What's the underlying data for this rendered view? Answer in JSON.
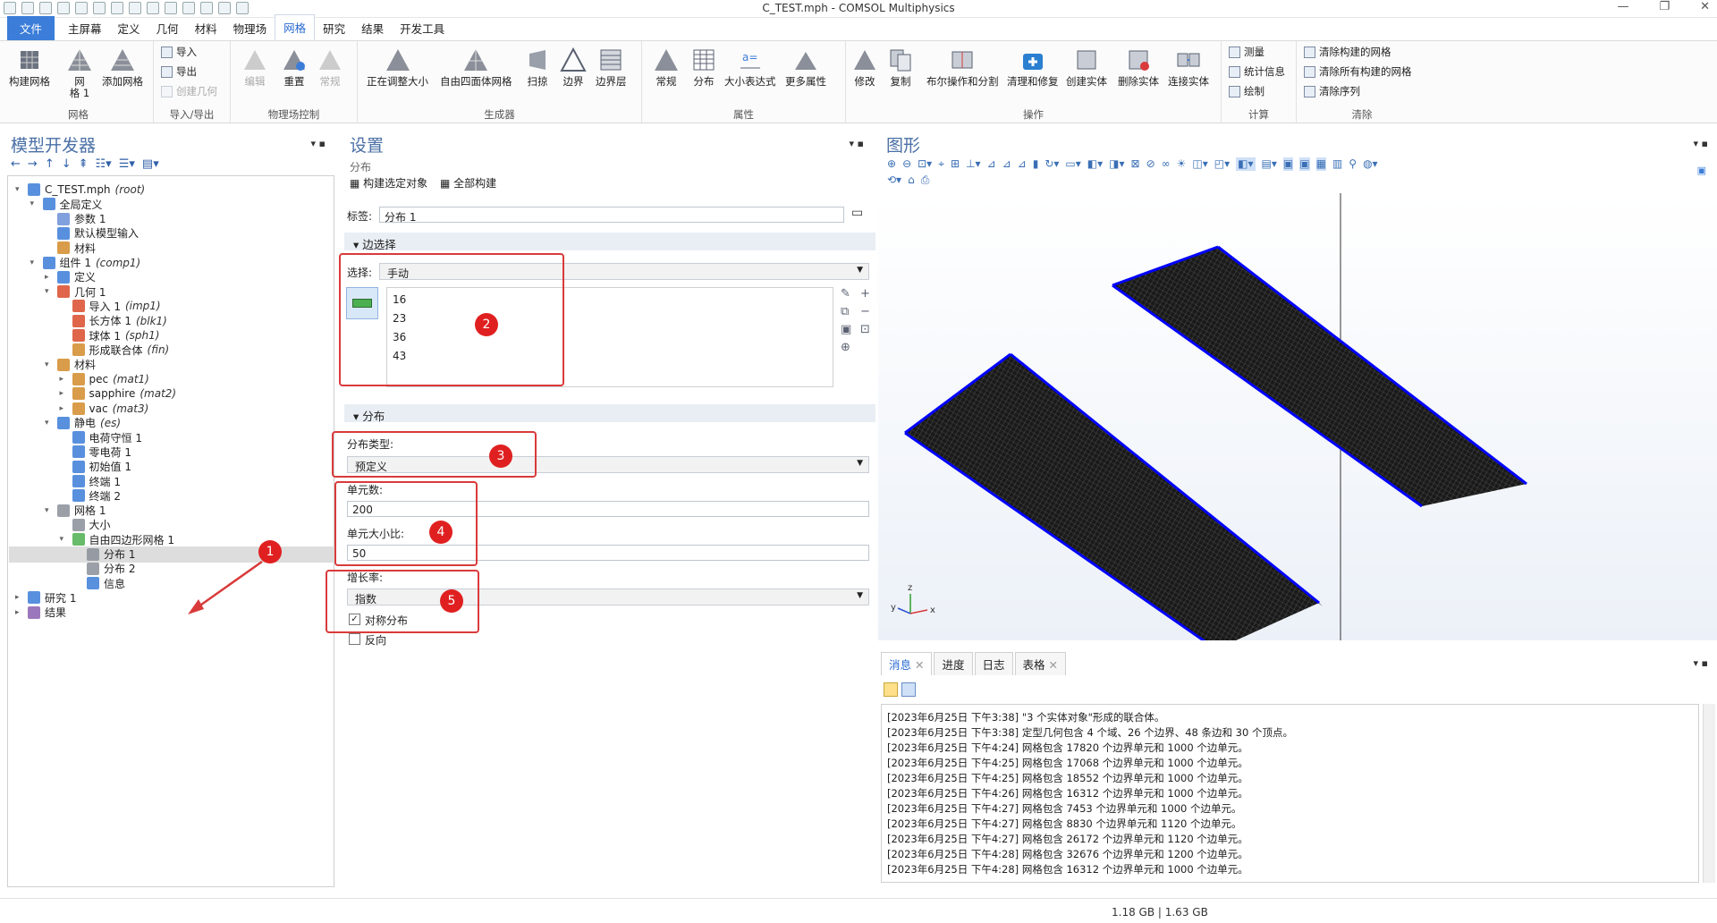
{
  "window": {
    "title": "C_TEST.mph - COMSOL Multiphysics"
  },
  "menu": [
    "文件",
    "主屏幕",
    "定义",
    "几何",
    "材料",
    "物理场",
    "网格",
    "研究",
    "结果",
    "开发工具"
  ],
  "ribbon": {
    "mesh_group": {
      "build_mesh": "构建网格",
      "mesh1": "网\n格 1",
      "add_mesh": "添加网格",
      "label": "网格"
    },
    "import_group": {
      "import": "导入",
      "export": "导出",
      "create_geom": "创建几何",
      "label": "导入/导出"
    },
    "physics_group": {
      "edit": "编辑",
      "reset": "重置",
      "normal": "常规",
      "label": "物理场控制"
    },
    "generator_group": {
      "adjust": "正在调整大小",
      "free_tet": "自由四面体网格",
      "sweep": "扫掠",
      "boundary": "边界",
      "boundary_layer": "边界层",
      "label": "生成器"
    },
    "attributes_group": {
      "normal": "常规",
      "distribution": "分布",
      "size_expr": "大小表达式",
      "more": "更多属性",
      "label": "属性"
    },
    "operations_group": {
      "modify": "修改",
      "copy": "复制",
      "boolean": "布尔操作和分割",
      "cleanup": "清理和修复",
      "create_entity": "创建实体",
      "delete_entity": "删除实体",
      "connect_entity": "连接实体",
      "label": "操作"
    },
    "compute_group": {
      "measure": "测量",
      "stats": "统计信息",
      "plot": "绘制",
      "label": "计算"
    },
    "clear_group": {
      "clear_built": "清除构建的网格",
      "clear_all": "清除所有构建的网格",
      "clear_seq": "清除序列",
      "label": "清除"
    }
  },
  "model_builder": {
    "title": "模型开发器",
    "tree": [
      {
        "label": "C_TEST.mph",
        "tag": "(root)"
      },
      {
        "label": "全局定义",
        "tag": ""
      },
      {
        "label": "参数 1",
        "tag": ""
      },
      {
        "label": "默认模型输入",
        "tag": ""
      },
      {
        "label": "材料",
        "tag": ""
      },
      {
        "label": "组件 1",
        "tag": "(comp1)"
      },
      {
        "label": "定义",
        "tag": ""
      },
      {
        "label": "几何 1",
        "tag": ""
      },
      {
        "label": "导入 1",
        "tag": "(imp1)"
      },
      {
        "label": "长方体 1",
        "tag": "(blk1)"
      },
      {
        "label": "球体 1",
        "tag": "(sph1)"
      },
      {
        "label": "形成联合体",
        "tag": "(fin)"
      },
      {
        "label": "材料",
        "tag": ""
      },
      {
        "label": "pec",
        "tag": "(mat1)"
      },
      {
        "label": "sapphire",
        "tag": "(mat2)"
      },
      {
        "label": "vac",
        "tag": "(mat3)"
      },
      {
        "label": "静电",
        "tag": "(es)"
      },
      {
        "label": "电荷守恒 1",
        "tag": ""
      },
      {
        "label": "零电荷 1",
        "tag": ""
      },
      {
        "label": "初始值 1",
        "tag": ""
      },
      {
        "label": "终端 1",
        "tag": ""
      },
      {
        "label": "终端 2",
        "tag": ""
      },
      {
        "label": "网格 1",
        "tag": ""
      },
      {
        "label": "大小",
        "tag": ""
      },
      {
        "label": "自由四边形网格 1",
        "tag": ""
      },
      {
        "label": "分布 1",
        "tag": ""
      },
      {
        "label": "分布 2",
        "tag": ""
      },
      {
        "label": "信息",
        "tag": ""
      },
      {
        "label": "研究 1",
        "tag": ""
      },
      {
        "label": "结果",
        "tag": ""
      }
    ]
  },
  "settings": {
    "title": "设置",
    "subtitle": "分布",
    "build_selected": "构建选定对象",
    "build_all": "全部构建",
    "label_caption": "标签:",
    "label_value": "分布 1",
    "edge_section": "边选择",
    "selection_caption": "选择:",
    "selection_value": "手动",
    "edges": [
      "16",
      "23",
      "36",
      "43"
    ],
    "dist_section": "分布",
    "dist_type_caption": "分布类型:",
    "dist_type_value": "预定义",
    "elements_caption": "单元数:",
    "elements_value": "200",
    "ratio_caption": "单元大小比:",
    "ratio_value": "50",
    "growth_caption": "增长率:",
    "growth_value": "指数",
    "symmetric": "对称分布",
    "reverse": "反向",
    "symmetric_checked": true,
    "reverse_checked": false
  },
  "badges": [
    "1",
    "2",
    "3",
    "4",
    "5"
  ],
  "graphics": {
    "title": "图形",
    "axis_x": "x",
    "axis_y": "y",
    "axis_z": "z"
  },
  "messages": {
    "tabs": [
      "消息",
      "进度",
      "日志",
      "表格"
    ],
    "lines": [
      "[2023年6月25日 下午3:38] \"3 个实体对象\"形成的联合体。",
      "[2023年6月25日 下午3:38] 定型几何包含 4 个域、26 个边界、48 条边和 30 个顶点。",
      "[2023年6月25日 下午4:24] 网格包含 17820 个边界单元和 1000 个边单元。",
      "[2023年6月25日 下午4:25] 网格包含 17068 个边界单元和 1000 个边单元。",
      "[2023年6月25日 下午4:25] 网格包含 18552 个边界单元和 1000 个边单元。",
      "[2023年6月25日 下午4:26] 网格包含 16312 个边界单元和 1000 个边单元。",
      "[2023年6月25日 下午4:27] 网格包含 7453 个边界单元和 1000 个边单元。",
      "[2023年6月25日 下午4:27] 网格包含 8830 个边界单元和 1120 个边单元。",
      "[2023年6月25日 下午4:27] 网格包含 26172 个边界单元和 1120 个边单元。",
      "[2023年6月25日 下午4:28] 网格包含 32676 个边界单元和 1200 个边单元。",
      "[2023年6月25日 下午4:28] 网格包含 16312 个边界单元和 1000 个边单元。"
    ]
  },
  "status": {
    "memory": "1.18 GB | 1.63 GB"
  },
  "colors": {
    "accent": "#3b7dd8",
    "annotation": "#d93a3a",
    "mesh_edge": "#0000ff"
  }
}
